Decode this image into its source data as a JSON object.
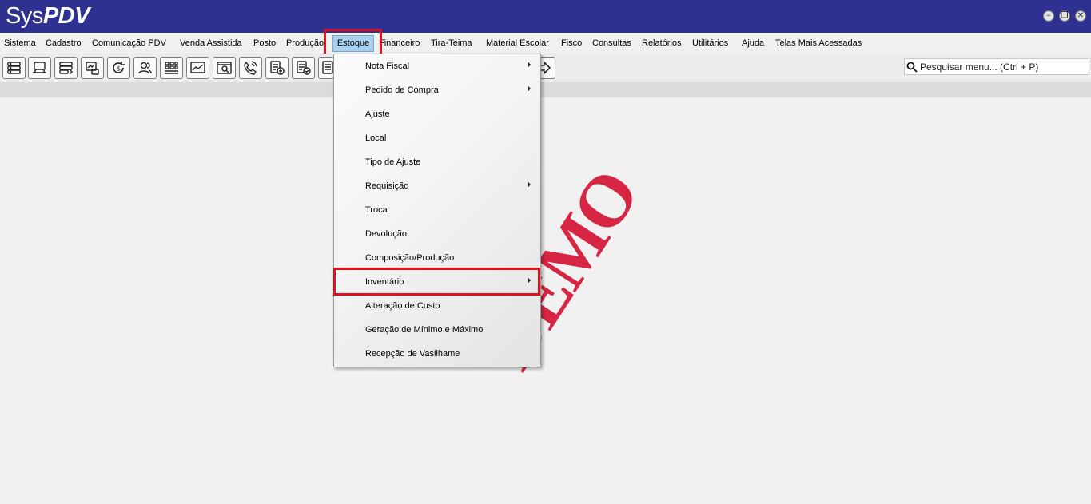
{
  "app": {
    "logo_regular": "Sys",
    "logo_bold": "PDV"
  },
  "window_controls": {
    "minimize": "–",
    "restore": "❐",
    "close": "✕"
  },
  "menubar": [
    {
      "label": "Sistema",
      "id": "sistema"
    },
    {
      "label": "Cadastro",
      "id": "cadastro"
    },
    {
      "label": "Comunicação PDV",
      "id": "comunicacao-pdv"
    },
    {
      "label": "Venda Assistida",
      "id": "venda-assistida"
    },
    {
      "label": "Posto",
      "id": "posto"
    },
    {
      "label": "Produção",
      "id": "producao"
    },
    {
      "label": "Estoque",
      "id": "estoque",
      "active": true
    },
    {
      "label": "Financeiro",
      "id": "financeiro"
    },
    {
      "label": "Tira-Teima",
      "id": "tira-teima"
    },
    {
      "label": "Material Escolar",
      "id": "material-escolar"
    },
    {
      "label": "Fisco",
      "id": "fisco"
    },
    {
      "label": "Consultas",
      "id": "consultas"
    },
    {
      "label": "Relatórios",
      "id": "relatorios"
    },
    {
      "label": "Utilitários",
      "id": "utilitarios"
    },
    {
      "label": "Ajuda",
      "id": "ajuda"
    },
    {
      "label": "Telas Mais Acessadas",
      "id": "telas-mais-acessadas"
    }
  ],
  "toolbar": {
    "icons": [
      "server-icon",
      "computer-icon",
      "pos-terminal-icon",
      "report-chart-icon",
      "refund-icon",
      "users-icon",
      "stock-shelf-icon",
      "chart-icon",
      "window-search-icon",
      "phone-icon",
      "document-add-icon",
      "document-check-icon",
      "document-list-icon",
      "export-arrow-icon"
    ]
  },
  "search": {
    "placeholder": "Pesquisar menu... (Ctrl + P)"
  },
  "estoque_menu": [
    {
      "label": "Nota Fiscal",
      "submenu": true
    },
    {
      "label": "Pedido de Compra",
      "submenu": true
    },
    {
      "label": "Ajuste",
      "submenu": false
    },
    {
      "label": "Local",
      "submenu": false
    },
    {
      "label": "Tipo de Ajuste",
      "submenu": false
    },
    {
      "label": "Requisição",
      "submenu": true
    },
    {
      "label": "Troca",
      "submenu": false
    },
    {
      "label": "Devolução",
      "submenu": false
    },
    {
      "label": "Composição/Produção",
      "submenu": false
    },
    {
      "label": "Inventário",
      "submenu": true,
      "highlighted": true
    },
    {
      "label": "Alteração de Custo",
      "submenu": false
    },
    {
      "label": "Geração de Mínimo e Máximo",
      "submenu": false
    },
    {
      "label": "Recepção de Vasilhame",
      "submenu": false
    }
  ],
  "watermark": {
    "text": "DEMO"
  },
  "colors": {
    "titlebar": "#2f3190",
    "highlight": "#e0101e",
    "watermark": "#d51c3a",
    "active_menu": "#aad1ef"
  }
}
